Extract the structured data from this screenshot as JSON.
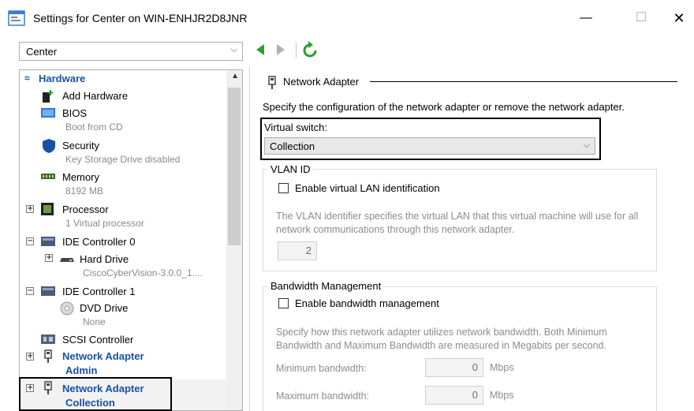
{
  "window": {
    "title": "Settings for Center on WIN-ENHJR2D8JNR",
    "min_glyph": "—",
    "max_glyph": "☐",
    "close_glyph": "✕"
  },
  "toolbar": {
    "vm_name": "Center",
    "chevron": "⌵"
  },
  "tree": {
    "hardware_header": "Hardware",
    "collapse_glyph": "≈",
    "items": [
      {
        "label": "Add Hardware",
        "icon": "add-hardware-icon"
      },
      {
        "label": "BIOS",
        "sub": "Boot from CD",
        "icon": "bios-icon"
      },
      {
        "label": "Security",
        "sub": "Key Storage Drive disabled",
        "icon": "shield-icon"
      },
      {
        "label": "Memory",
        "sub": "8192 MB",
        "icon": "memory-icon"
      },
      {
        "label": "Processor",
        "sub": "1 Virtual processor",
        "icon": "processor-icon"
      },
      {
        "label": "IDE Controller 0",
        "icon": "ide-controller-icon"
      },
      {
        "label": "Hard Drive",
        "sub": "CiscoCyberVision-3.0.0_1....",
        "icon": "hard-drive-icon"
      },
      {
        "label": "IDE Controller 1",
        "icon": "ide-controller-icon"
      },
      {
        "label": "DVD Drive",
        "sub": "None",
        "icon": "dvd-drive-icon"
      },
      {
        "label": "SCSI Controller",
        "icon": "scsi-controller-icon"
      },
      {
        "label": "Network Adapter",
        "sub": "Admin",
        "icon": "network-adapter-icon"
      },
      {
        "label": "Network Adapter",
        "sub": "Collection",
        "icon": "network-adapter-icon"
      }
    ],
    "expand_plus": "+",
    "expand_minus": "−",
    "scroll_up": "▲"
  },
  "panel": {
    "section_title": "Network Adapter",
    "description": "Specify the configuration of the network adapter or remove the network adapter.",
    "virtual_switch_label": "Virtual switch:",
    "virtual_switch_value": "Collection",
    "vlan": {
      "title": "VLAN ID",
      "checkbox_label": "Enable virtual LAN identification",
      "help_line1": "The VLAN identifier specifies the virtual LAN that this virtual machine will use for all",
      "help_line2": "network communications through this network adapter.",
      "value": "2"
    },
    "bandwidth": {
      "title": "Bandwidth Management",
      "checkbox_label": "Enable bandwidth management",
      "help_line1": "Specify how this network adapter utilizes network bandwidth. Both Minimum",
      "help_line2": "Bandwidth and Maximum Bandwidth are measured in Megabits per second.",
      "min_label": "Minimum bandwidth:",
      "min_value": "0",
      "max_label": "Maximum bandwidth:",
      "max_value": "0",
      "unit": "Mbps"
    }
  },
  "colors": {
    "accent_blue": "#1750a8",
    "nav_green": "#2e9e2e"
  }
}
